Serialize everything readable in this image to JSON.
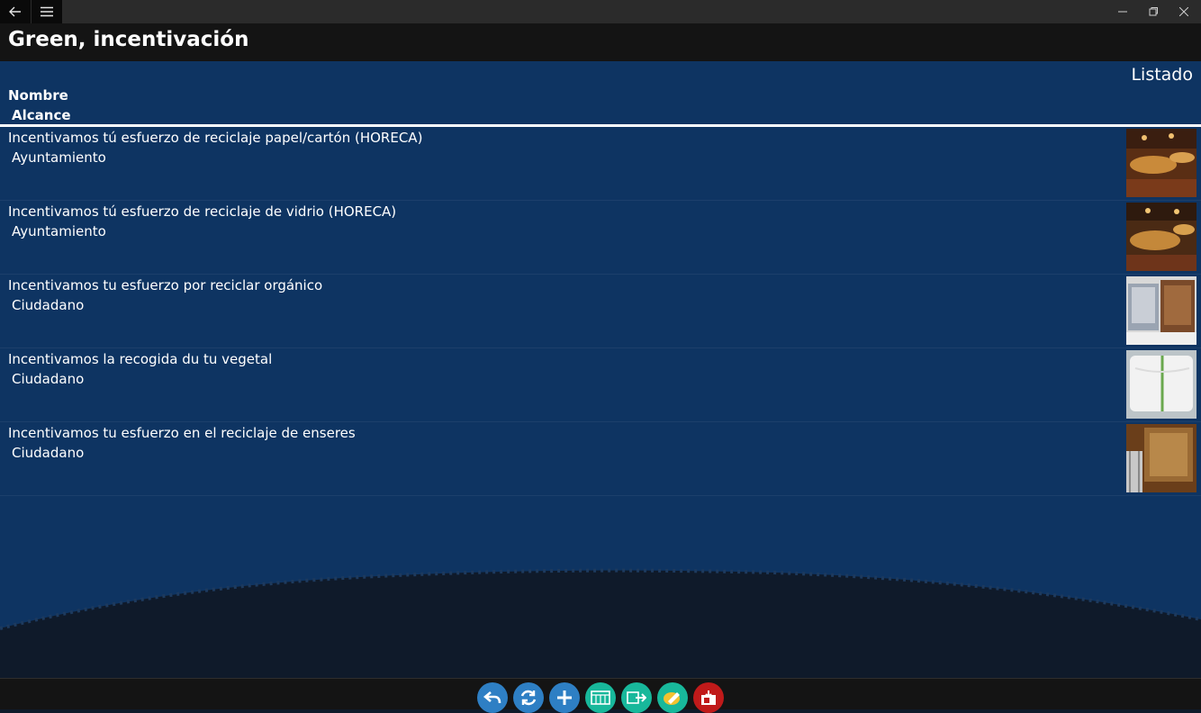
{
  "window": {
    "back_icon": "back-arrow-icon",
    "menu_icon": "hamburger-icon",
    "controls": [
      "minimize-icon",
      "maximize-icon",
      "close-icon"
    ]
  },
  "header": {
    "title": "Green, incentivación"
  },
  "view": {
    "label": "Listado"
  },
  "columns": {
    "name": "Nombre",
    "scope": "Alcance"
  },
  "items": [
    {
      "name": "Incentivamos tú esfuerzo de reciclaje papel/cartón (HORECA)",
      "scope": "Ayuntamiento",
      "thumb": "restaurant-photo"
    },
    {
      "name": "Incentivamos tú esfuerzo de reciclaje de vidrio (HORECA)",
      "scope": "Ayuntamiento",
      "thumb": "restaurant-photo"
    },
    {
      "name": "Incentivamos tu esfuerzo por reciclar orgánico",
      "scope": "Ciudadano",
      "thumb": "bins-photo"
    },
    {
      "name": "Incentivamos la recogida du tu vegetal",
      "scope": "Ciudadano",
      "thumb": "bag-photo"
    },
    {
      "name": "Incentivamos tu esfuerzo en el reciclaje de enseres",
      "scope": "Ciudadano",
      "thumb": "furniture-photo"
    }
  ],
  "appbar": [
    {
      "icon": "undo-icon",
      "color": "#2e7fc4"
    },
    {
      "icon": "refresh-icon",
      "color": "#2e7fc4"
    },
    {
      "icon": "add-icon",
      "color": "#2e7fc4"
    },
    {
      "icon": "calendar-icon",
      "color": "#18b89b"
    },
    {
      "icon": "export-icon",
      "color": "#18b89b"
    },
    {
      "icon": "edit-icon",
      "color": "#18b89b"
    },
    {
      "icon": "mail-icon",
      "color": "#c01a1a"
    }
  ],
  "colors": {
    "main_bg": "#0e3462",
    "titlebar": "#2b2b2b",
    "header": "#141414"
  }
}
